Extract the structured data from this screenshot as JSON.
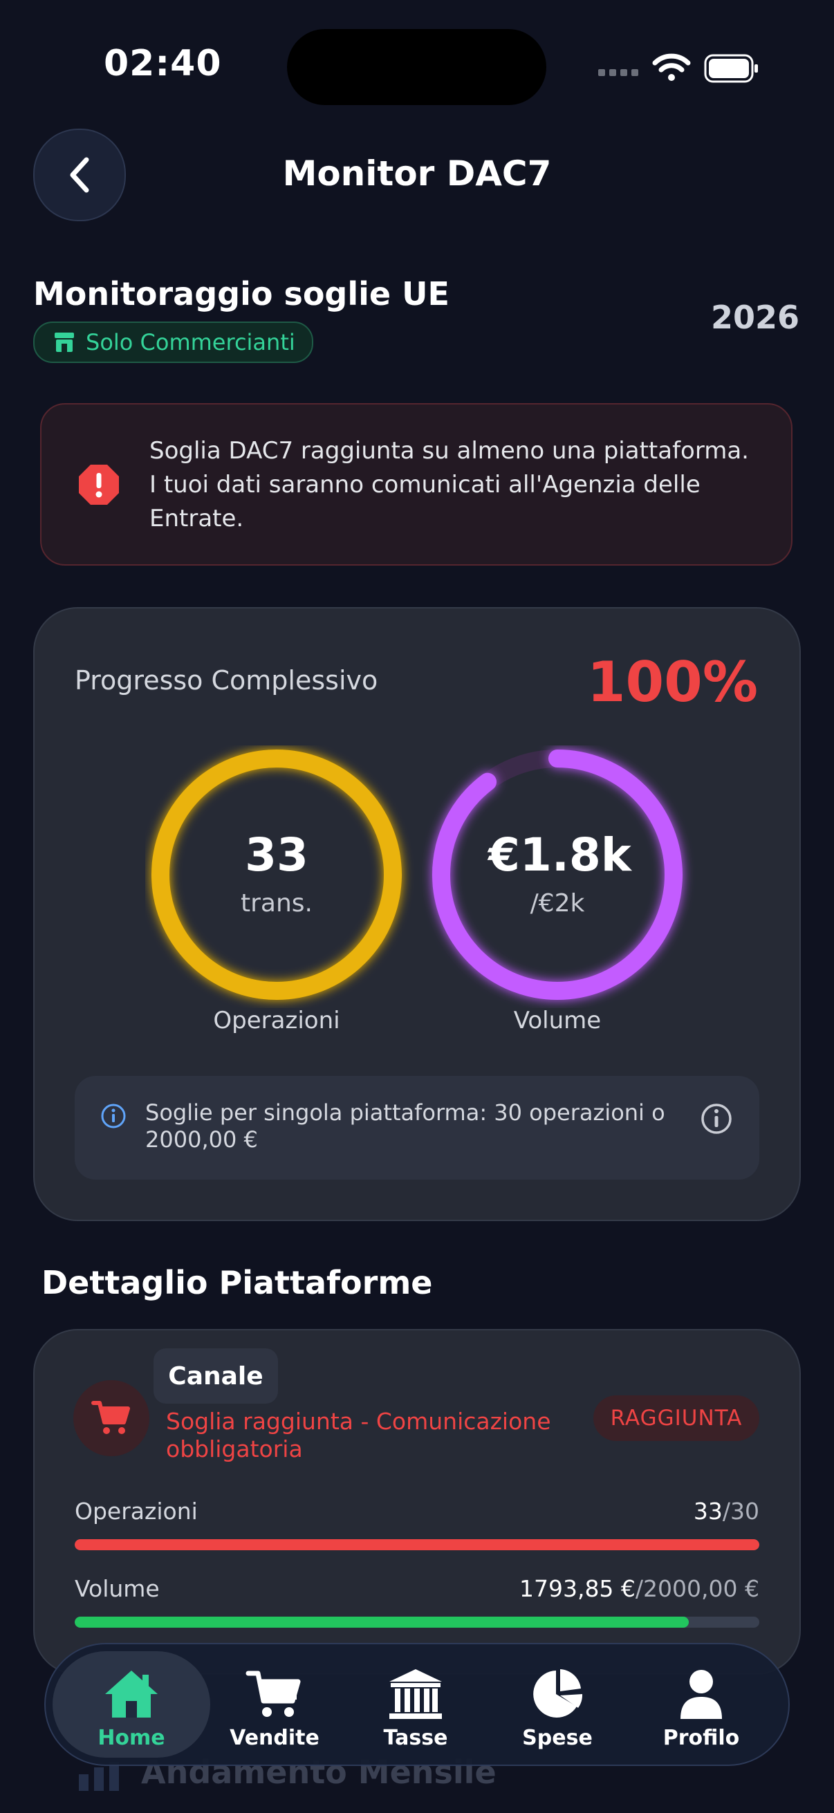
{
  "status_bar": {
    "time": "02:40"
  },
  "header": {
    "title": "Monitor DAC7"
  },
  "section": {
    "title": "Monitoraggio soglie UE",
    "badge": "Solo Commercianti",
    "year": "2026"
  },
  "alert": {
    "text": "Soglia DAC7 raggiunta su almeno una piattaforma. I tuoi dati saranno comunicati all'Agenzia delle Entrate."
  },
  "progress": {
    "label": "Progresso Complessivo",
    "percent": "100%",
    "operations": {
      "value": "33",
      "sub": "trans.",
      "caption": "Operazioni",
      "fraction": 1.0,
      "color": "#eab308"
    },
    "volume": {
      "value": "€1.8k",
      "sub": "/€2k",
      "caption": "Volume",
      "fraction": 0.897,
      "color": "#c35cff"
    },
    "info": "Soglie per singola piattaforma: 30 operazioni o 2000,00 €"
  },
  "platforms": {
    "title": "Dettaglio Piattaforme",
    "items": [
      {
        "tooltip": "Canale",
        "status_text": "Soglia raggiunta - Comunicazione obbligatoria",
        "status_pill": "RAGGIUNTA",
        "operations": {
          "label": "Operazioni",
          "current": "33",
          "max": "/30",
          "fraction": 1.0,
          "color": "#ef4444"
        },
        "volume": {
          "label": "Volume",
          "current": "1793,85 €",
          "max": "/2000,00 €",
          "fraction": 0.897,
          "color": "#22c55e"
        }
      }
    ]
  },
  "faded_section": {
    "title": "Andamento Mensile"
  },
  "tabbar": {
    "items": [
      {
        "label": "Home",
        "icon": "home-icon",
        "active": true
      },
      {
        "label": "Vendite",
        "icon": "cart-icon",
        "active": false
      },
      {
        "label": "Tasse",
        "icon": "bank-icon",
        "active": false
      },
      {
        "label": "Spese",
        "icon": "pie-chart-icon",
        "active": false
      },
      {
        "label": "Profilo",
        "icon": "user-icon",
        "active": false
      }
    ]
  },
  "colors": {
    "accent": "#34d399",
    "danger": "#ef4444",
    "background": "#0f1220"
  }
}
